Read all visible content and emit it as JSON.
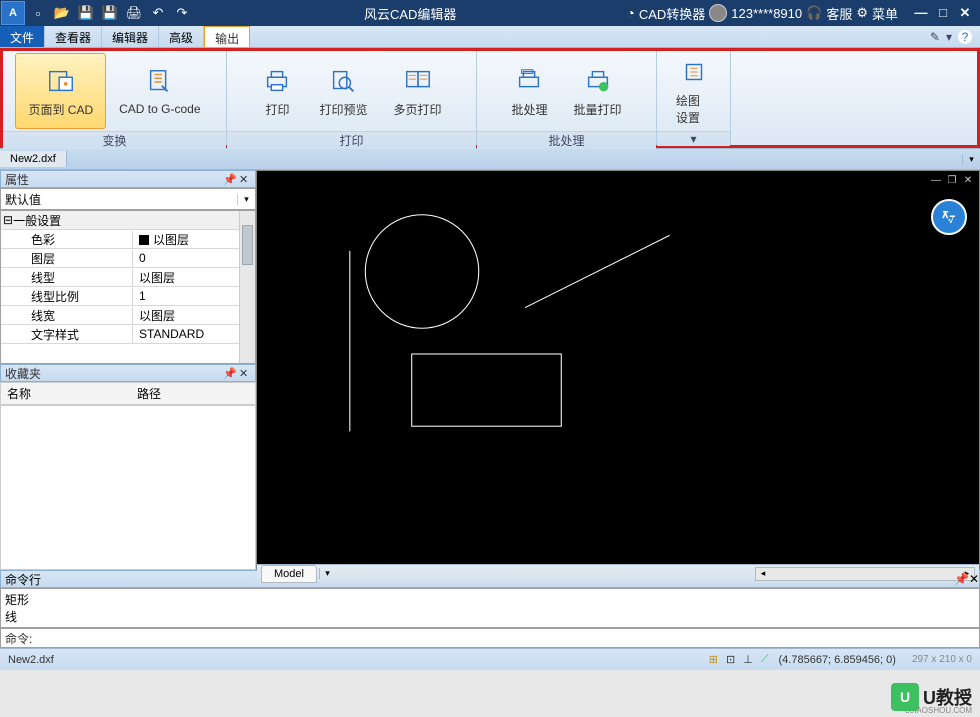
{
  "titlebar": {
    "title": "风云CAD编辑器",
    "converter": "CAD转换器",
    "user": "123****8910",
    "support": "客服",
    "menu": "菜单"
  },
  "menubar": {
    "items": [
      "文件",
      "查看器",
      "编辑器",
      "高级",
      "输出"
    ]
  },
  "ribbon": {
    "groups": [
      {
        "label": "变换",
        "buttons": [
          {
            "label": "页面到 CAD",
            "name": "page-to-cad-button",
            "sel": true
          },
          {
            "label": "CAD to G-code",
            "name": "cad-to-gcode-button"
          }
        ]
      },
      {
        "label": "打印",
        "buttons": [
          {
            "label": "打印",
            "name": "print-button"
          },
          {
            "label": "打印预览",
            "name": "print-preview-button"
          },
          {
            "label": "多页打印",
            "name": "multipage-print-button"
          }
        ]
      },
      {
        "label": "批处理",
        "buttons": [
          {
            "label": "批处理",
            "name": "batch-button"
          },
          {
            "label": "批量打印",
            "name": "batch-print-button"
          }
        ]
      },
      {
        "label": "",
        "buttons": [
          {
            "label": "绘图设置",
            "name": "drawing-settings-button",
            "drop": true
          }
        ]
      }
    ]
  },
  "doctab": "New2.dxf",
  "props": {
    "title": "属性",
    "default": "默认值",
    "section": "一般设置",
    "rows": [
      {
        "k": "色彩",
        "v": "以图层",
        "sw": true
      },
      {
        "k": "图层",
        "v": "0"
      },
      {
        "k": "线型",
        "v": "以图层"
      },
      {
        "k": "线型比例",
        "v": "1"
      },
      {
        "k": "线宽",
        "v": "以图层"
      },
      {
        "k": "文字样式",
        "v": "STANDARD"
      }
    ]
  },
  "fav": {
    "title": "收藏夹",
    "cols": [
      "名称",
      "路径"
    ]
  },
  "modeltab": "Model",
  "cmd": {
    "title": "命令行",
    "history": "矩形\n线",
    "label": "命令:"
  },
  "status": {
    "file": "New2.dxf",
    "coords": "(4.785667; 6.859456; 0)",
    "dims": "297 x 210 x 0"
  },
  "watermark": {
    "text": "U教授",
    "domain": "UJIAOSHOU.COM"
  }
}
